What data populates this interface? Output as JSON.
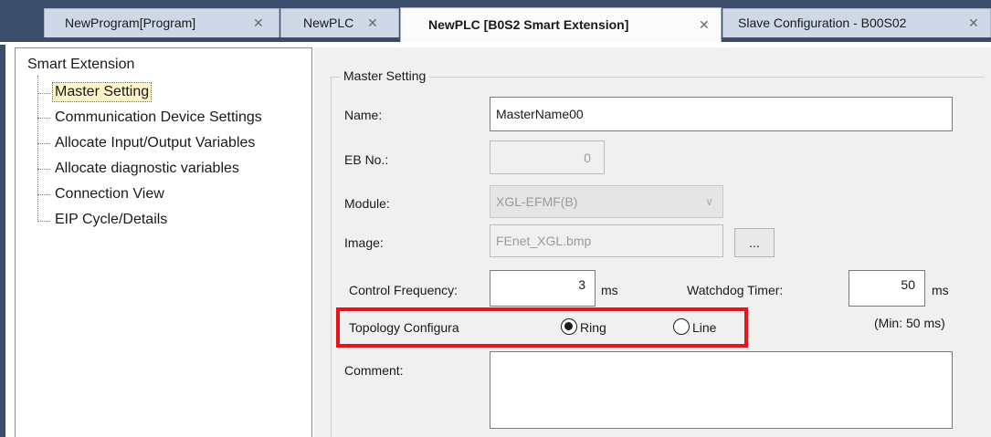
{
  "tabs": [
    {
      "label": "NewProgram[Program]",
      "close": "✕"
    },
    {
      "label": "NewPLC",
      "close": "✕"
    },
    {
      "label": "NewPLC [B0S2 Smart Extension]",
      "close": "✕"
    },
    {
      "label": "Slave Configuration - B00S02",
      "close": "✕"
    }
  ],
  "tree": {
    "root": "Smart Extension",
    "items": [
      "Master Setting",
      "Communication Device Settings",
      "Allocate Input/Output Variables",
      "Allocate diagnostic variables",
      "Connection View",
      "EIP Cycle/Details"
    ]
  },
  "master_setting": {
    "group_title": "Master Setting",
    "name_label": "Name:",
    "name_value": "MasterName00",
    "eb_label": "EB No.:",
    "eb_value": "0",
    "module_label": "Module:",
    "module_value": "XGL-EFMF(B)",
    "image_label": "Image:",
    "image_value": "FEnet_XGL.bmp",
    "browse_label": "...",
    "control_freq_label": "Control Frequency:",
    "control_freq_value": "3",
    "control_freq_unit": "ms",
    "watchdog_label": "Watchdog Timer:",
    "watchdog_value": "50",
    "watchdog_unit": "ms",
    "watchdog_min": "(Min: 50 ms)",
    "topology_label": "Topology Configura",
    "topology_options": [
      "Ring",
      "Line"
    ],
    "topology_selected": "Ring",
    "comment_label": "Comment:"
  },
  "colors": {
    "highlight": "#e8141c",
    "tab_strip": "#3c4d6b",
    "selected_tree_item": "#fff4c8"
  }
}
